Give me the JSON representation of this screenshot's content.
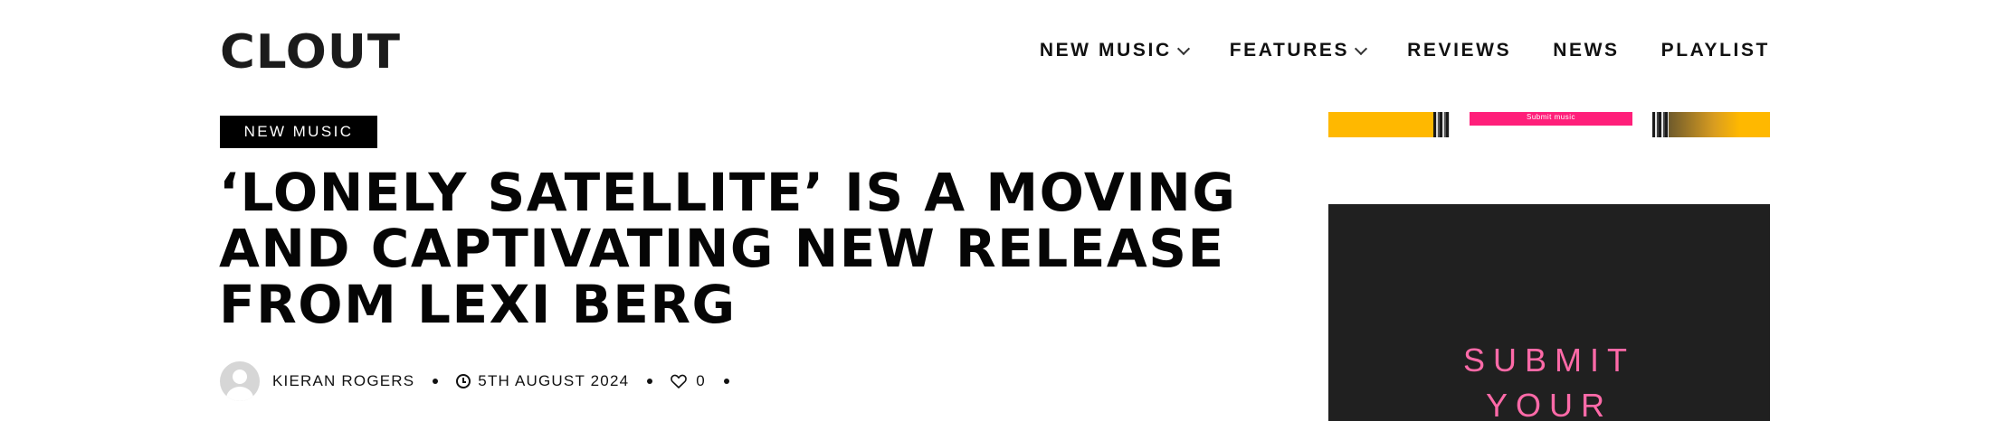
{
  "header": {
    "logo_text": "CLOUT",
    "nav": [
      {
        "label": "NEW MUSIC",
        "has_dropdown": true
      },
      {
        "label": "FEATURES",
        "has_dropdown": true
      },
      {
        "label": "REVIEWS",
        "has_dropdown": false
      },
      {
        "label": "NEWS",
        "has_dropdown": false
      },
      {
        "label": "PLAYLIST",
        "has_dropdown": false
      }
    ]
  },
  "article": {
    "category": "NEW MUSIC",
    "title": "‘LONELY SATELLITE’ IS A MOVING\nAND CAPTIVATING NEW RELEASE\nFROM LEXI BERG",
    "author": "KIERAN ROGERS",
    "date": "5TH AUGUST 2024",
    "likes": "0"
  },
  "sidebar": {
    "ad_banner_text": "Submit music",
    "submit_text": "SUBMIT\nYOUR"
  },
  "colors": {
    "accent_pink": "#ff6aa8",
    "banner_pink": "#ff1f7a",
    "banner_yellow": "#ffb800",
    "panel_dark": "#202020"
  }
}
